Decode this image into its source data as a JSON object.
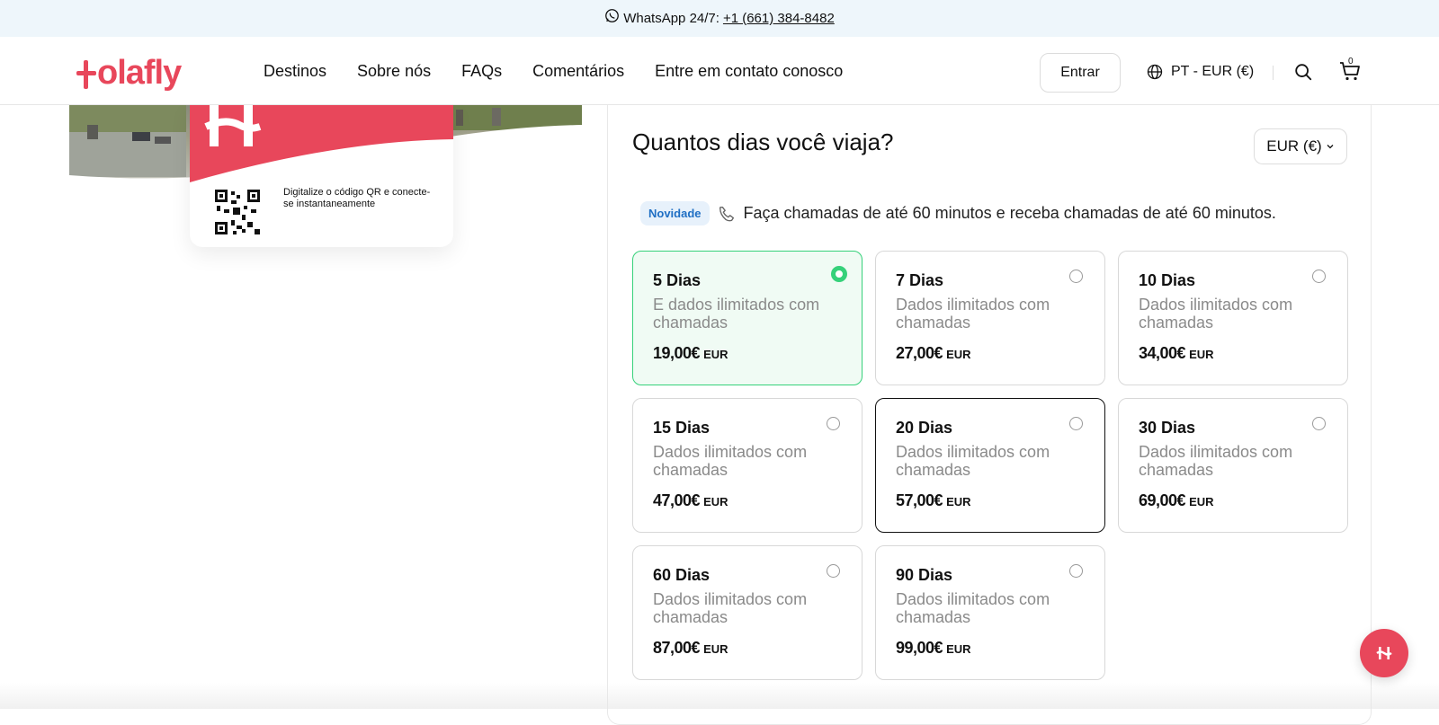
{
  "topbar": {
    "whatsapp_label": "WhatsApp 24/7:",
    "phone": "+1 (661) 384-8482"
  },
  "header": {
    "logo_text": "olafly",
    "nav": [
      "Destinos",
      "Sobre nós",
      "FAQs",
      "Comentários",
      "Entre em contato conosco"
    ],
    "login_label": "Entrar",
    "language_label": "PT - EUR (€)",
    "cart_count": "0"
  },
  "card": {
    "qr_text": "Digitalize o código QR e conecte-se instantaneamente"
  },
  "panel": {
    "title": "Quantos dias você viaja?",
    "currency": "EUR (€)",
    "badge": "Novidade",
    "notice": "Faça chamadas de até 60 minutos e receba chamadas de até 60 minutos."
  },
  "plans": [
    {
      "name": "5 Dias",
      "desc": "E dados ilimitados com chamadas",
      "price": "19,00€",
      "currency": "EUR",
      "selected": true
    },
    {
      "name": "7 Dias",
      "desc": "Dados ilimitados com chamadas",
      "price": "27,00€",
      "currency": "EUR",
      "selected": false
    },
    {
      "name": "10 Dias",
      "desc": "Dados ilimitados com chamadas",
      "price": "34,00€",
      "currency": "EUR",
      "selected": false
    },
    {
      "name": "15 Dias",
      "desc": "Dados ilimitados com chamadas",
      "price": "47,00€",
      "currency": "EUR",
      "selected": false
    },
    {
      "name": "20 Dias",
      "desc": "Dados ilimitados com chamadas",
      "price": "57,00€",
      "currency": "EUR",
      "selected": false
    },
    {
      "name": "30 Dias",
      "desc": "Dados ilimitados com chamadas",
      "price": "69,00€",
      "currency": "EUR",
      "selected": false
    },
    {
      "name": "60 Dias",
      "desc": "Dados ilimitados com chamadas",
      "price": "87,00€",
      "currency": "EUR",
      "selected": false
    },
    {
      "name": "90 Dias",
      "desc": "Dados ilimitados com chamadas",
      "price": "99,00€",
      "currency": "EUR",
      "selected": false
    }
  ],
  "colors": {
    "brand": "#e8475b",
    "selected": "#36d17a",
    "badge_text": "#1f6fc4"
  }
}
